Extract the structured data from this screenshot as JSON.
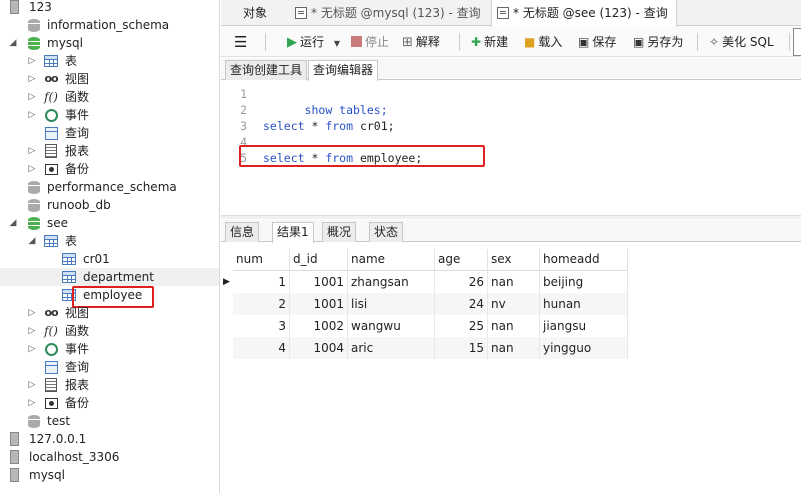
{
  "tree": {
    "items": [
      {
        "label": "123"
      },
      {
        "label": "information_schema"
      },
      {
        "label": "mysql"
      },
      {
        "label": "表"
      },
      {
        "label": "视图"
      },
      {
        "label": "函数"
      },
      {
        "label": "事件"
      },
      {
        "label": "查询"
      },
      {
        "label": "报表"
      },
      {
        "label": "备份"
      },
      {
        "label": "performance_schema"
      },
      {
        "label": "runoob_db"
      },
      {
        "label": "see"
      },
      {
        "label": "表"
      },
      {
        "label": "cr01"
      },
      {
        "label": "department"
      },
      {
        "label": "employee"
      },
      {
        "label": "视图"
      },
      {
        "label": "函数"
      },
      {
        "label": "事件"
      },
      {
        "label": "查询"
      },
      {
        "label": "报表"
      },
      {
        "label": "备份"
      },
      {
        "label": "test"
      },
      {
        "label": "127.0.0.1"
      },
      {
        "label": "localhost_3306"
      },
      {
        "label": "mysql"
      }
    ],
    "func_glyph": "f()"
  },
  "tabs": [
    {
      "label": "对象"
    },
    {
      "label": "* 无标题 @mysql (123) - 查询"
    },
    {
      "label": "* 无标题 @see (123) - 查询"
    }
  ],
  "toolbar": {
    "menu_glyph": "☰",
    "run": "运行",
    "stop": "停止",
    "explain": "解释",
    "new": "新建",
    "load": "载入",
    "save": "保存",
    "save_as": "另存为",
    "beautify": "美化 SQL"
  },
  "subtabs": [
    "查询创建工具",
    "查询编辑器"
  ],
  "editor": {
    "line_numbers": [
      "1",
      "2",
      "3",
      "4",
      "5"
    ],
    "lines": [
      {
        "kw1": "show tables;",
        "rest": ""
      },
      {
        "kw1": "",
        "rest": ""
      },
      {
        "kw1": "select",
        "mid": " * ",
        "kw2": "from",
        "rest": " cr01;"
      },
      {
        "kw1": "",
        "rest": ""
      },
      {
        "kw1": "select",
        "mid": " * ",
        "kw2": "from",
        "rest": " employee;"
      }
    ]
  },
  "result_tabs": [
    "信息",
    "结果1",
    "概况",
    "状态"
  ],
  "grid": {
    "columns": [
      "num",
      "d_id",
      "name",
      "age",
      "sex",
      "homeadd"
    ],
    "rows": [
      [
        "1",
        "1001",
        "zhangsan",
        "26",
        "nan",
        "beijing"
      ],
      [
        "2",
        "1001",
        "lisi",
        "24",
        "nv",
        "hunan"
      ],
      [
        "3",
        "1002",
        "wangwu",
        "25",
        "nan",
        "jiangsu"
      ],
      [
        "4",
        "1004",
        "aric",
        "15",
        "nan",
        "yingguo"
      ]
    ],
    "current_row_marker": "▶"
  },
  "colors": {
    "keyword": "#2a51c9",
    "highlight_box": "#e02020",
    "db_open": "#4caf50",
    "run_green": "#2ea44f"
  }
}
